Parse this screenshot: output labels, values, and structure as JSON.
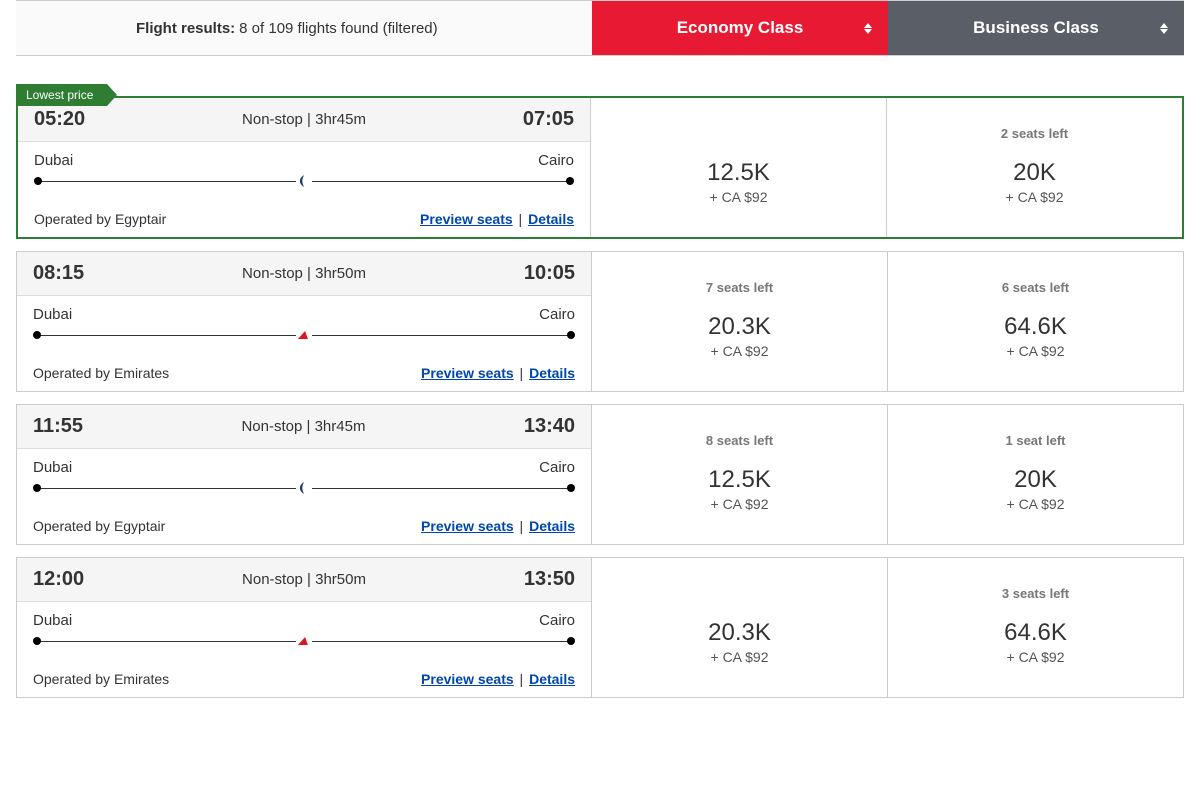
{
  "header": {
    "results_label": "Flight results:",
    "results_text": "8 of 109 flights found (filtered)",
    "economy_label": "Economy Class",
    "business_label": "Business Class"
  },
  "lowest_price_label": "Lowest price",
  "flights": [
    {
      "lowest": true,
      "dep_time": "05:20",
      "arr_time": "07:05",
      "stops": "Non-stop",
      "duration": "3hr45m",
      "origin": "Dubai",
      "dest": "Cairo",
      "operated_by": "Operated by Egyptair",
      "airline": "egyptair",
      "preview_label": "Preview seats",
      "details_label": "Details",
      "economy": {
        "seats": "",
        "points": "12.5K",
        "extra": "+ CA $92"
      },
      "business": {
        "seats": "2 seats left",
        "points": "20K",
        "extra": "+ CA $92"
      }
    },
    {
      "lowest": false,
      "dep_time": "08:15",
      "arr_time": "10:05",
      "stops": "Non-stop",
      "duration": "3hr50m",
      "origin": "Dubai",
      "dest": "Cairo",
      "operated_by": "Operated by Emirates",
      "airline": "emirates",
      "preview_label": "Preview seats",
      "details_label": "Details",
      "economy": {
        "seats": "7 seats left",
        "points": "20.3K",
        "extra": "+ CA $92"
      },
      "business": {
        "seats": "6 seats left",
        "points": "64.6K",
        "extra": "+ CA $92"
      }
    },
    {
      "lowest": false,
      "dep_time": "11:55",
      "arr_time": "13:40",
      "stops": "Non-stop",
      "duration": "3hr45m",
      "origin": "Dubai",
      "dest": "Cairo",
      "operated_by": "Operated by Egyptair",
      "airline": "egyptair",
      "preview_label": "Preview seats",
      "details_label": "Details",
      "economy": {
        "seats": "8 seats left",
        "points": "12.5K",
        "extra": "+ CA $92"
      },
      "business": {
        "seats": "1 seat left",
        "points": "20K",
        "extra": "+ CA $92"
      }
    },
    {
      "lowest": false,
      "dep_time": "12:00",
      "arr_time": "13:50",
      "stops": "Non-stop",
      "duration": "3hr50m",
      "origin": "Dubai",
      "dest": "Cairo",
      "operated_by": "Operated by Emirates",
      "airline": "emirates",
      "preview_label": "Preview seats",
      "details_label": "Details",
      "economy": {
        "seats": "",
        "points": "20.3K",
        "extra": "+ CA $92"
      },
      "business": {
        "seats": "3 seats left",
        "points": "64.6K",
        "extra": "+ CA $92"
      }
    }
  ]
}
